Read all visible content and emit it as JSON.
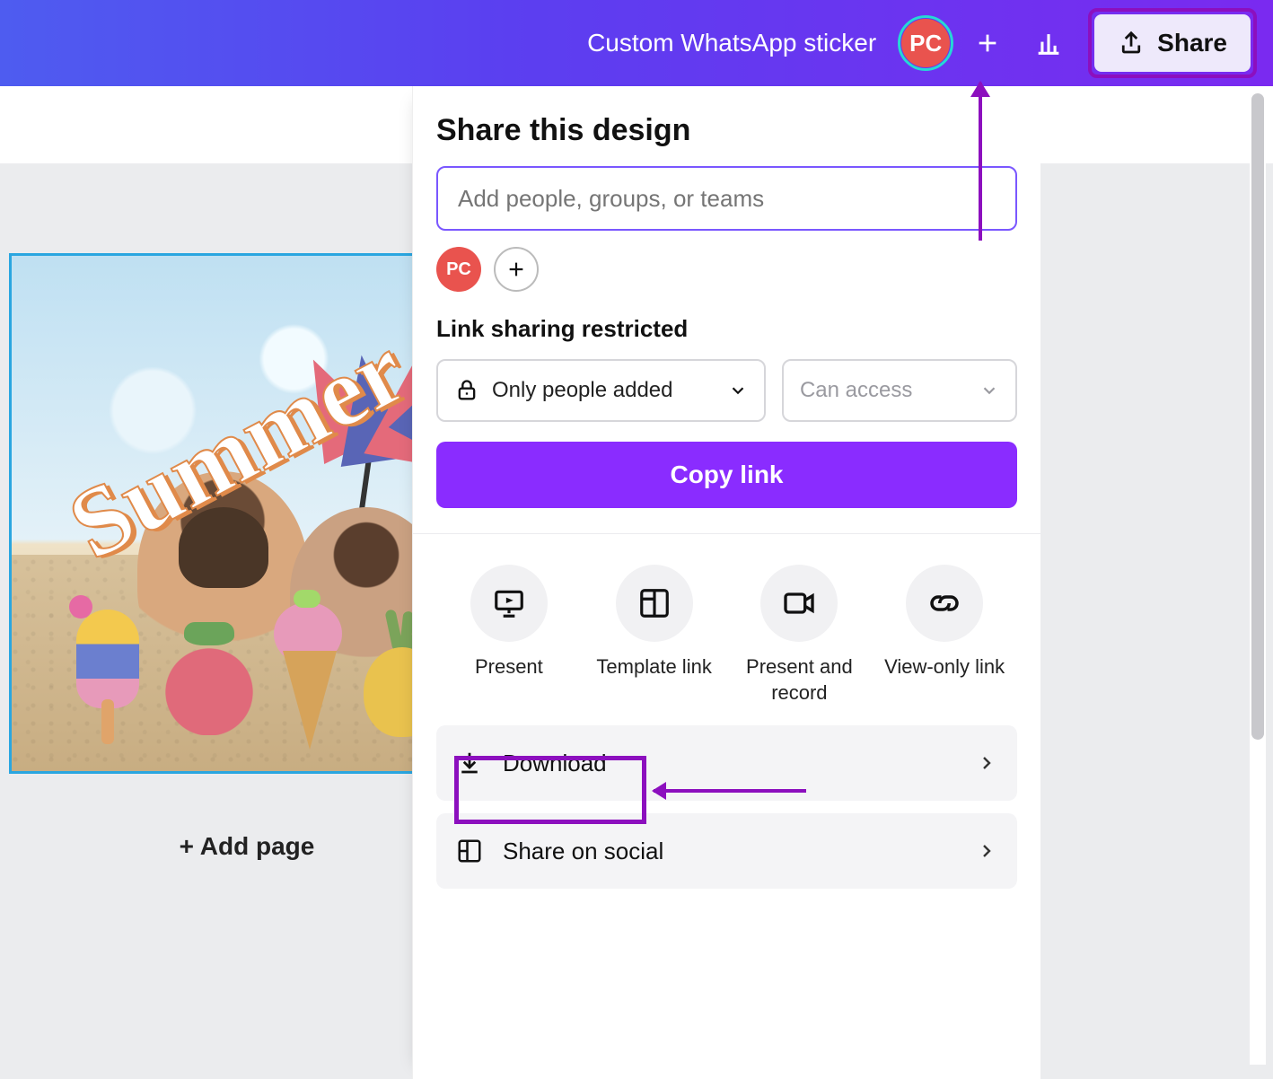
{
  "header": {
    "doc_title": "Custom WhatsApp sticker",
    "user_initials": "PC",
    "share_label": "Share"
  },
  "canvas": {
    "summer_text": "Summer",
    "add_page_label": "+ Add page"
  },
  "share_panel": {
    "title": "Share this design",
    "people_placeholder": "Add people, groups, or teams",
    "member_initials": "PC",
    "link_section_label": "Link sharing restricted",
    "visibility_label": "Only people added",
    "permission_label": "Can access",
    "copy_link_label": "Copy link",
    "actions": [
      {
        "icon": "present-icon",
        "label": "Present"
      },
      {
        "icon": "template-link-icon",
        "label": "Template link"
      },
      {
        "icon": "present-record-icon",
        "label": "Present and record"
      },
      {
        "icon": "view-only-link-icon",
        "label": "View-only link"
      }
    ],
    "list": [
      {
        "icon": "download-icon",
        "label": "Download"
      },
      {
        "icon": "share-social-icon",
        "label": "Share on social"
      }
    ]
  }
}
